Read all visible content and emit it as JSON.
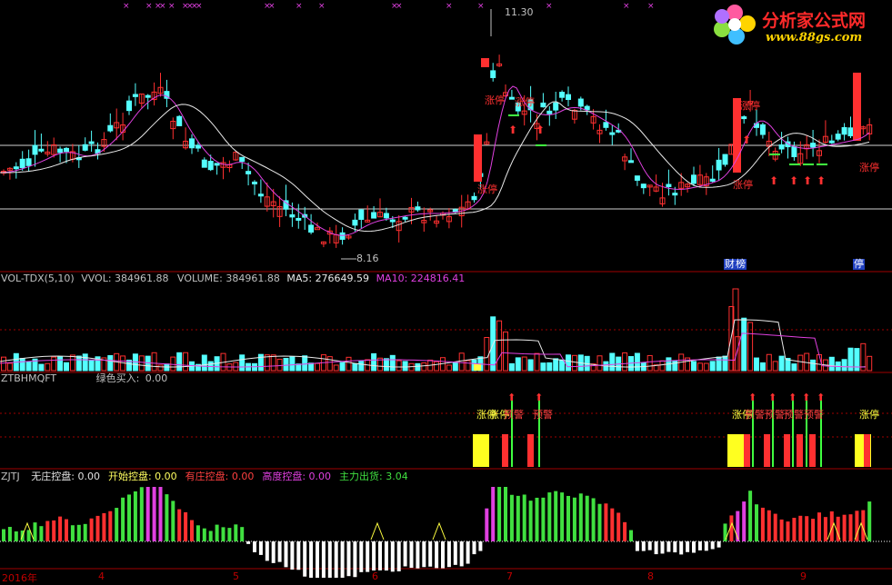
{
  "logo": {
    "title": "分析家公式网",
    "url": "www.88gs.com"
  },
  "price_panel": {
    "high_marker": "11.30",
    "low_marker": "8.16",
    "limit_up_label": "涨停",
    "badge_finance": "财",
    "badge_bang": "榜",
    "badge_stop": "停"
  },
  "vol_panel": {
    "name": "VOL-TDX(5,10)",
    "vvol_label": "VVOL:",
    "vvol_value": "384961.88",
    "volume_label": "VOLUME:",
    "volume_value": "384961.88",
    "ma5_label": "MA5:",
    "ma5_value": "276649.59",
    "ma10_label": "MA10:",
    "ma10_value": "224816.41"
  },
  "ztbh_panel": {
    "name": "ZTBHMQFT",
    "green_buy_label": "绿色买入:",
    "green_buy_value": "0.00",
    "limit_label": "涨停",
    "warn_label": "预警"
  },
  "zjtj_panel": {
    "name": "ZJTJ",
    "items": [
      {
        "label": "无庄控盘:",
        "value": "0.00",
        "color": "#e0e0e0"
      },
      {
        "label": "开始控盘:",
        "value": "0.00",
        "color": "#ffff60"
      },
      {
        "label": "有庄控盘:",
        "value": "0.00",
        "color": "#ff4040"
      },
      {
        "label": "高度控盘:",
        "value": "0.00",
        "color": "#e040e0"
      },
      {
        "label": "主力出货:",
        "value": "3.04",
        "color": "#40e040"
      }
    ]
  },
  "time_axis": {
    "labels": [
      "2016年",
      "4",
      "5",
      "6",
      "7",
      "8",
      "9"
    ]
  },
  "colors": {
    "up": "#ff3030",
    "down": "#54ffff",
    "ma_white": "#e8e8e8",
    "ma_magenta": "#e040e0",
    "grid": "#a00000"
  }
}
